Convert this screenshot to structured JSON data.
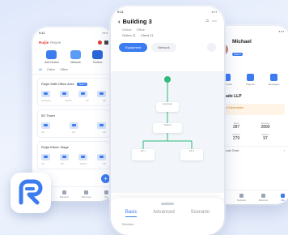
{
  "left_phone": {
    "time": "9:41",
    "brand": "Ruijie",
    "brand_suffix": "Reyee",
    "quick_actions": [
      "Add Device",
      "Network",
      "Toolbox"
    ],
    "filters": [
      "All",
      "Online",
      "Offline"
    ],
    "cards": [
      {
        "title": "Ruijie SMB Office Area",
        "tag": "Alarm",
        "devices": [
          "Gateway",
          "Switch",
          "AP",
          "AP"
        ]
      },
      {
        "title": "5G Tower",
        "tag": "",
        "devices": [
          "AP",
          "AP",
          "AP"
        ]
      },
      {
        "title": "Ruijie Ethnic Stage",
        "tag": "",
        "devices": [
          "AP",
          "AP",
          "Switch",
          "AP"
        ]
      }
    ],
    "fab_symbol": "+",
    "tabs": [
      "Project",
      "Network",
      "Discover",
      "Me"
    ]
  },
  "center_phone": {
    "time": "9:41",
    "title": "Building 3",
    "meta_line1": [
      "Online",
      "Office"
    ],
    "meta_line2": [
      "Online 11",
      "Client 21"
    ],
    "segments": [
      "Equipment",
      "Network"
    ],
    "active_segment": "Equipment",
    "topology_nodes": [
      "Gateway",
      "Switch",
      "AP 1",
      "AP 2"
    ],
    "sheet_tabs": [
      "Basic",
      "Advanced",
      "Scenario"
    ],
    "active_sheet_tab": "Basic",
    "sheet_label": "Devices"
  },
  "right_phone": {
    "time": "9:41",
    "user_name": "Michael",
    "user_tag": "Admin",
    "shortcuts": [
      "Accounts",
      "Projects",
      "Messages"
    ],
    "org_name": "IR Trade LLP",
    "subscription_text": "Cloud Subscription",
    "stats": [
      {
        "label": "Sites",
        "value": "287"
      },
      {
        "label": "Devices",
        "value": "2890"
      },
      {
        "label": "Clients",
        "value": "279"
      },
      {
        "label": "Alarms",
        "value": "97"
      }
    ],
    "row_label": "View Route Chart",
    "tabs": [
      "Project",
      "Network",
      "Discover",
      "Me"
    ]
  },
  "logo": {
    "name": "reyee-logo",
    "color": "#3c7bf0"
  },
  "colors": {
    "accent": "#3c7bf0",
    "background": "#e6eefc"
  }
}
